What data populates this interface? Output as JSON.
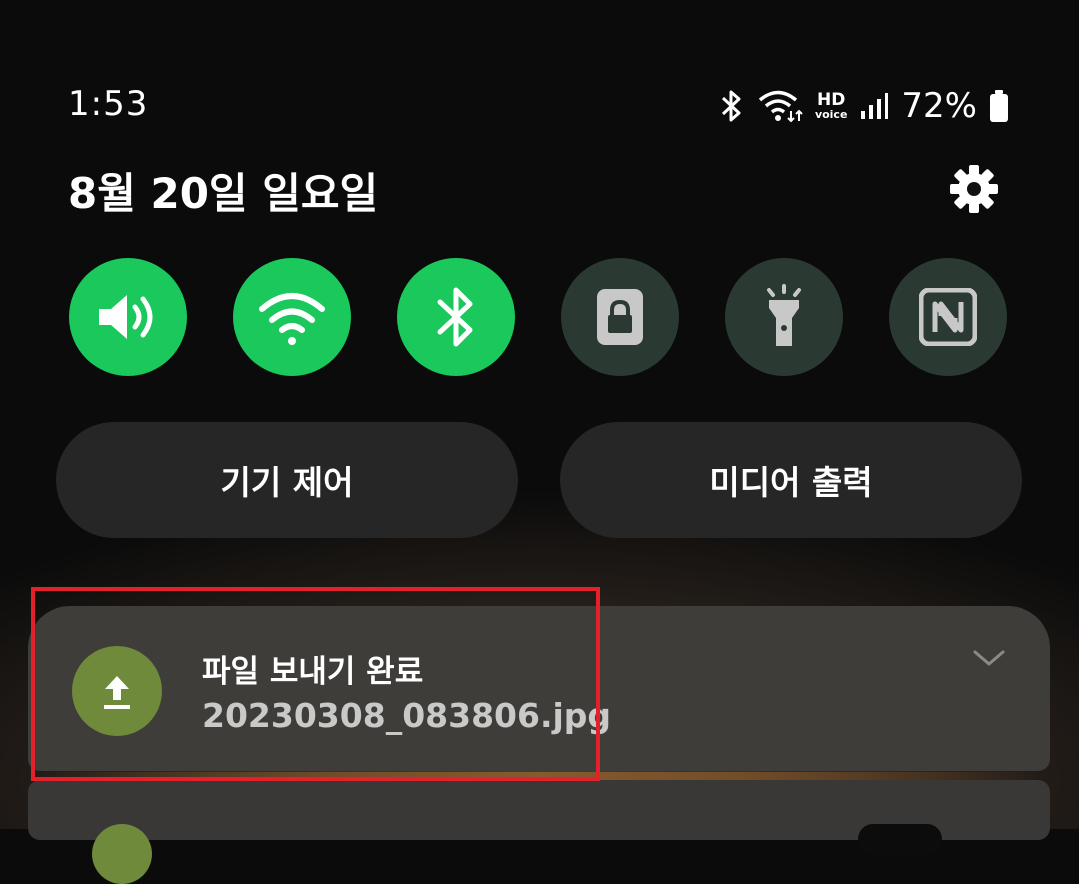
{
  "status_bar": {
    "time": "1:53",
    "hd_label": "HD",
    "voice_label": "voice",
    "battery": "72%"
  },
  "header": {
    "date": "8월 20일 일요일"
  },
  "quick_settings": [
    {
      "name": "sound",
      "state": "on",
      "icon": "speaker-icon"
    },
    {
      "name": "wifi",
      "state": "on",
      "icon": "wifi-icon"
    },
    {
      "name": "bluetooth",
      "state": "on",
      "icon": "bluetooth-icon"
    },
    {
      "name": "screen-lock",
      "state": "off",
      "icon": "lock-icon"
    },
    {
      "name": "flashlight",
      "state": "off",
      "icon": "flashlight-icon"
    },
    {
      "name": "nfc",
      "state": "off",
      "icon": "nfc-icon"
    }
  ],
  "buttons": {
    "device_control": "기기 제어",
    "media_output": "미디어 출력"
  },
  "notification": {
    "title": "파일 보내기 완료",
    "subtitle": "20230308_083806.jpg",
    "icon": "upload-icon"
  },
  "colors": {
    "toggle_on": "#1ac85c",
    "toggle_off": "#2a3a33",
    "notification_icon": "#6e8a3a",
    "highlight": "#e4202a"
  }
}
